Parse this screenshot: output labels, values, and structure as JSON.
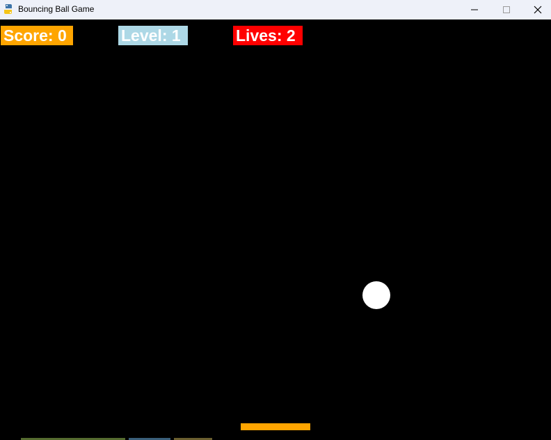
{
  "window": {
    "title": "Bouncing Ball Game",
    "app_icon": "python-icon",
    "minimize_icon": "minimize-icon",
    "maximize_icon": "maximize-icon",
    "close_icon": "close-icon"
  },
  "hud": {
    "score_text": "Score: 0",
    "level_text": "Level: 1",
    "lives_text": "Lives: 2"
  },
  "colors": {
    "background": "#000000",
    "titlebar": "#eef1f9",
    "score_bg": "#ffa500",
    "level_bg": "#add8e6",
    "lives_bg": "#ff0000",
    "ball": "#ffffff",
    "paddle": "#ffa500"
  }
}
